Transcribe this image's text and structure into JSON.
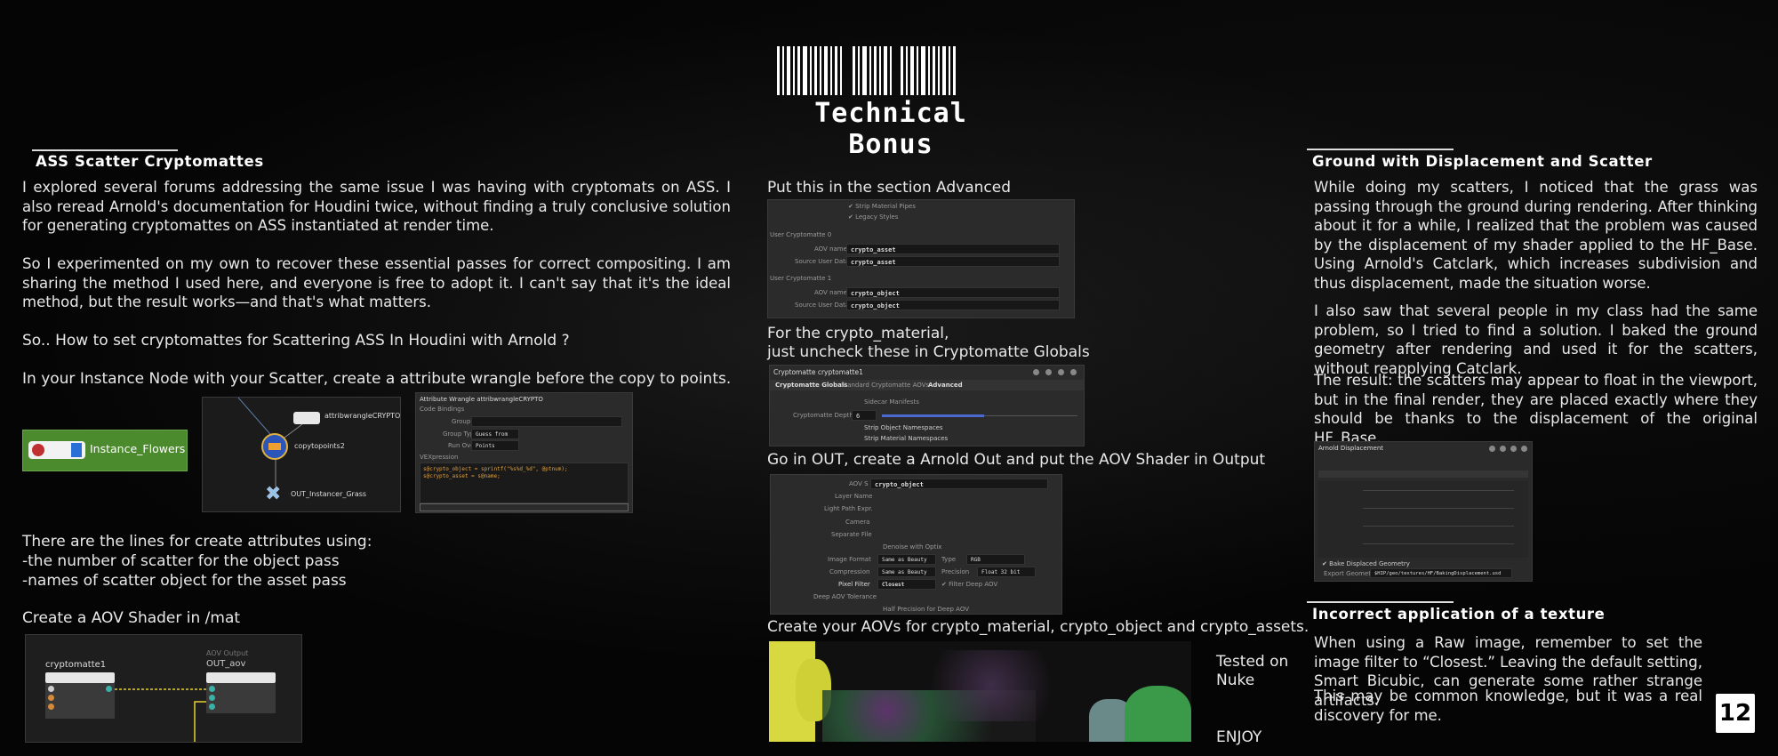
{
  "header": {
    "title": "Technical Bonus"
  },
  "left": {
    "title": "ASS Scatter Cryptomattes",
    "p1": "I explored several forums addressing the same issue I was having with cryptomats on ASS. I also reread Arnold's documentation for Houdini twice, without finding a truly conclusive solution for generating cryptomattes on ASS instantiated at render time.",
    "p2": "So I experimented on my own to recover these essential passes for correct compositing. I am sharing the method I used here, and everyone is free to adopt it. I can't say that it's the ideal method, but the result works—and that's what matters.",
    "p3": "So.. How to set cryptomattes for Scattering ASS In Houdini with Arnold ?",
    "p4": "In your Instance Node with your Scatter, create a attribute wrangle before the copy to points.",
    "node_instance": "Instance_Flowers",
    "node_wrangle": "attribwrangleCRYPTO",
    "node_copy": "copytopoints2",
    "node_out": "OUT_Instancer_Grass",
    "wrangle_header": "Attribute Wrangle  attribwrangleCRYPTO",
    "wrangle_tabs": "Code   Bindings",
    "wrangle_group": "Group",
    "wrangle_group_type": "Group Type",
    "wrangle_group_type_val": "Guess from Group",
    "wrangle_run_over": "Run Over",
    "wrangle_run_over_val": "Points",
    "wrangle_vex_label": "VEXpression",
    "wrangle_code1": "s@crypto_object = sprintf(\"%s%d_%d\", @ptnum);",
    "wrangle_code2": "s@crypto_asset = s@name;",
    "lines_intro": "There are the lines for create attributes using:",
    "lines_a": "-the number of scatter for the object pass",
    "lines_b": "-names of scatter object for the asset pass",
    "aov_shader": "Create a AOV Shader in /mat",
    "node_crypto": "cryptomatte1",
    "node_out_aov": "OUT_aov",
    "node_output_label": "AOV Output"
  },
  "middle": {
    "advanced_caption": "Put this in the section Advanced",
    "strip_pipes": "Strip Material Pipes",
    "legacy_styles": "Legacy Styles",
    "user_crypto0": "User Cryptomatte 0",
    "user_crypto1": "User Cryptomatte 1",
    "aov_name_label": "AOV name",
    "source_user_data_label": "Source User Data",
    "crypto_asset": "crypto_asset",
    "crypto_object": "crypto_object",
    "crypto_material_caption1": "For the crypto_material,",
    "crypto_material_caption2": "just uncheck these in Cryptomatte Globals",
    "crypto_header": "Cryptomatte  cryptomatte1",
    "tab_globals": "Cryptomatte Globals",
    "tab_standard": "Standard Cryptomatte AOVs",
    "tab_advanced": "Advanced",
    "sidecar": "Sidecar Manifests",
    "crypto_depth_label": "Cryptomatte Depth",
    "crypto_depth_val": "6",
    "strip_obj_ns": "Strip Object Namespaces",
    "strip_mat_ns": "Strip Material Namespaces",
    "out_caption": "Go in OUT, create a Arnold Out and put the AOV Shader in Output",
    "aov_s_label": "AOV S",
    "layer_name": "Layer Name",
    "light_path": "Light Path Expr.",
    "camera": "Camera",
    "separate_file": "Separate File",
    "denoise": "Denoise with Optix",
    "image_format": "Image Format",
    "same_as_beauty": "Same as Beauty",
    "type_label": "Type",
    "type_val": "RGB",
    "compression": "Compression",
    "precision_label": "Precision",
    "precision_val": "Float 32 bit",
    "pixel_filter": "Pixel Filter",
    "pixel_filter_val": "Closest",
    "filter_deep": "Filter Deep AOV",
    "deep_tol": "Deep AOV Tolerance",
    "half_prec": "Half Precision for Deep AOV",
    "create_aovs": "Create your AOVs for crypto_material, crypto_object and crypto_assets.",
    "tested_on": "Tested on",
    "nuke": "Nuke",
    "enjoy": "ENJOY"
  },
  "right": {
    "title1": "Ground with Displacement and Scatter",
    "p1": "While doing my scatters, I noticed that the grass was passing through the ground during rendering. After thinking about it for a while, I realized that the problem was caused by the displacement of my shader applied to the HF_Base. Using Arnold's Catclark, which increases subdivision and thus displacement, made the situation worse.",
    "p2": "I also saw that several people in my class had the same problem, so I tried to find a solution. I baked the ground geometry after rendering and used it for the scatters, without reapplying Catclark.",
    "p3": "The result: the scatters may appear to float in the viewport, but in the final render, they are placed exactly where they should be thanks to the displacement of the original HF_Base.",
    "arnold_header": "Arnold  Displacement",
    "bake_label": "Bake Displaced Geometry",
    "export_geo": "Export Geometry",
    "export_path": "$HIP/geo/textures/HF/BakingDisplacement.usd",
    "title2": "Incorrect application of a texture",
    "p4": "When using a Raw image, remember to set the image filter to “Closest.” Leaving the default setting, Smart Bicubic, can generate some rather strange artifacts.",
    "p5": "This may be common knowledge, but it was a real discovery for me."
  },
  "page": {
    "number": "12"
  }
}
